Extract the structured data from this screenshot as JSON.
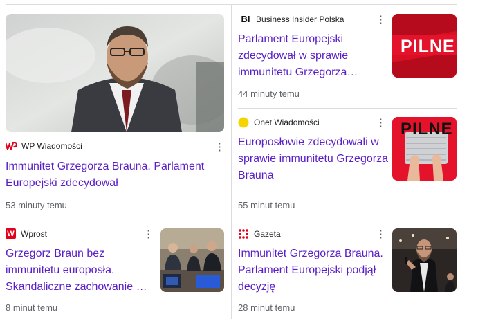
{
  "cards": [
    {
      "source": "WP Wiadomości",
      "title": "Immunitet Grzegorza Brauna. Parlament Europejski zdecydował",
      "time": "53 minuty temu"
    },
    {
      "source": "Business Insider Polska",
      "logo_text": "BI",
      "title": "Parlament Europejski zdecydował w sprawie immunitetu Grzegorza…",
      "time": "44 minuty temu",
      "thumb_text": "PILNE"
    },
    {
      "source": "Onet Wiadomości",
      "title": "Europosłowie zdecydowali w sprawie immunitetu Grzegorza Brauna",
      "time": "55 minut temu",
      "thumb_text": "PILNE"
    },
    {
      "source": "Wprost",
      "logo_text": "W",
      "title": "Grzegorz Braun bez immunitetu europosła. Skandaliczne zachowanie …",
      "time": "8 minut temu"
    },
    {
      "source": "Gazeta",
      "title": "Immunitet Grzegorza Brauna. Parlament Europejski podjął decyzję",
      "time": "28 minut temu"
    }
  ],
  "colors": {
    "title": "#5a1fc7",
    "pilne_red": "#e5122b",
    "wp_red": "#e3001b",
    "onet_yellow": "#f5d400"
  },
  "icons": {
    "menu": "more-vert-icon"
  }
}
